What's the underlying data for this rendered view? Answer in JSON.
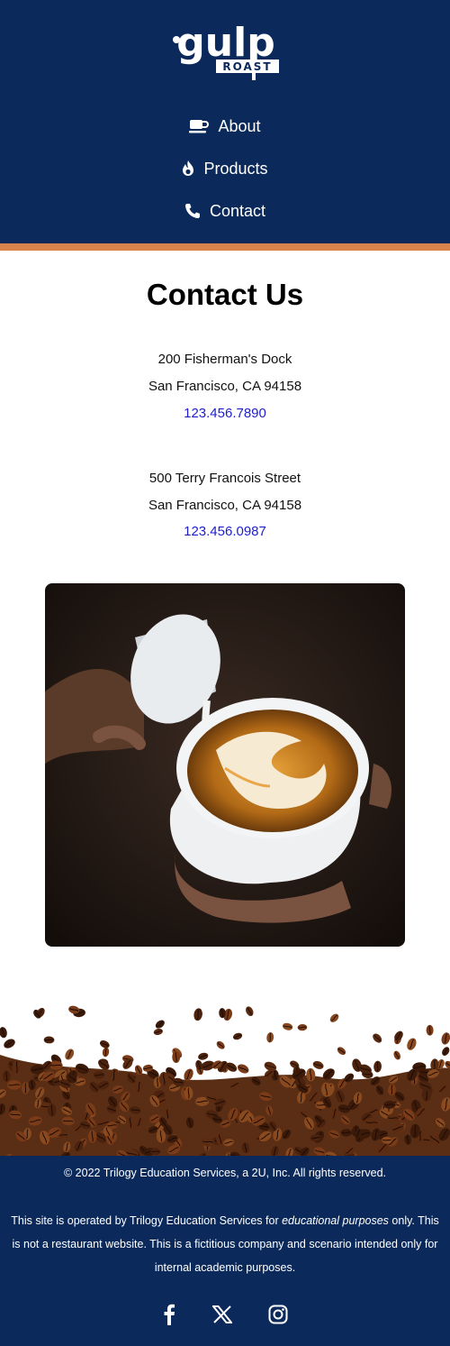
{
  "brand": {
    "logo_main": "gulp",
    "logo_sub": "ROAST"
  },
  "nav": {
    "items": [
      {
        "label": "About",
        "icon": "coffee-cup-icon"
      },
      {
        "label": "Products",
        "icon": "fire-icon"
      },
      {
        "label": "Contact",
        "icon": "phone-icon"
      }
    ]
  },
  "main": {
    "title": "Contact Us",
    "locations": [
      {
        "street": "200 Fisherman's Dock",
        "city": "San Francisco, CA 94158",
        "phone": "123.456.7890"
      },
      {
        "street": "500 Terry Francois Street",
        "city": "San Francisco, CA 94158",
        "phone": "123.456.0987"
      }
    ]
  },
  "footer": {
    "copyright": "© 2022 Trilogy Education Services, a 2U, Inc. All rights reserved.",
    "disclaimer_before": "This site is operated by Trilogy Education Services for ",
    "disclaimer_em": "educational purposes",
    "disclaimer_after": " only. This is not a restaurant website. This is a fictitious company and scenario intended only for internal academic purposes.",
    "social": [
      "facebook-icon",
      "x-icon",
      "instagram-icon"
    ]
  },
  "colors": {
    "navy": "#0b2a5b",
    "accent": "#d9834c",
    "link": "#1d1dcc"
  }
}
